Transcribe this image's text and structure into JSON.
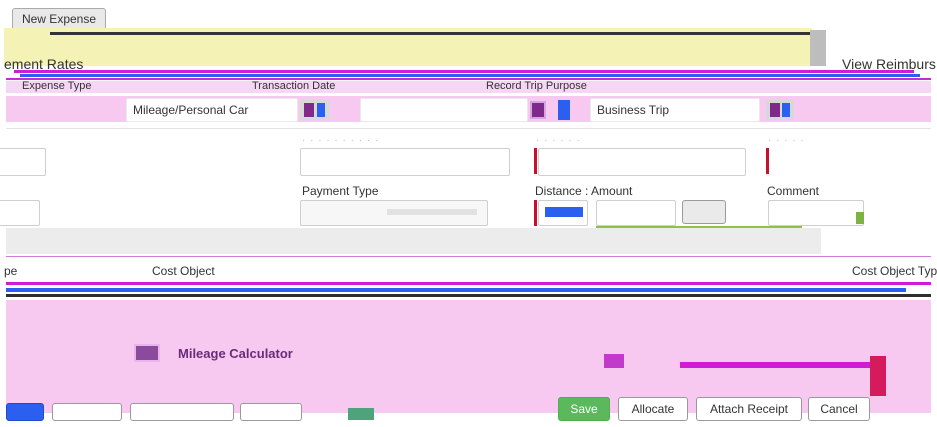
{
  "header": {
    "new_expense_label": "New Expense",
    "left_link": "ement Rates",
    "right_link": "View Reimburs"
  },
  "form": {
    "col_expense_type": "Expense Type",
    "col_transaction_date": "Transaction Date",
    "col_record_trip_purpose": "Record Trip Purpose",
    "expense_type_value": "Mileage/Personal Car",
    "trip_purpose_value": "Business Trip",
    "payment_type_label": "Payment Type",
    "distance_amount_label": "Distance : Amount",
    "comment_label": "Comment"
  },
  "allocation": {
    "col_type_partial": "pe",
    "col_cost_object": "Cost Object",
    "col_cost_object_type": "Cost Object Typ"
  },
  "mileage": {
    "calculator_title": "Mileage Calculator"
  },
  "actions": {
    "save": "Save",
    "allocate": "Allocate",
    "attach_receipt": "Attach Receipt",
    "cancel": "Cancel"
  },
  "colors": {
    "accent_magenta": "#f7c9f1",
    "pale_yellow": "#f4f3b5",
    "save_green": "#5cb85c",
    "required_red": "#c8102e",
    "stripe_blue": "#2a5ff0",
    "stripe_magenta": "#d21bd6"
  }
}
